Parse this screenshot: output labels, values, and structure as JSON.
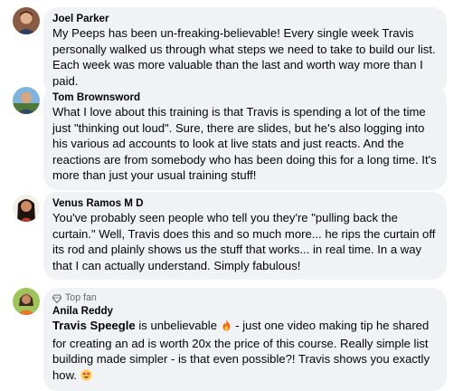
{
  "comments": [
    {
      "author": "Joel Parker",
      "text": "My Peeps has been un-freaking-believable! Every single week Travis personally walked us through what steps we need to take to build our list. Each week was more valuable than the last and worth way more than I paid."
    },
    {
      "author": "Tom Brownsword",
      "text": "What I love about this training is that Travis is spending a lot of the time just \"thinking out loud\". Sure, there are slides, but he's also logging into his various ad accounts to look at live stats and just reacts. And the reactions are from somebody who has been doing this for a long time. It's more than just your usual training stuff!"
    },
    {
      "author": "Venus Ramos M D",
      "text": "You've probably seen people who tell you they're \"pulling back the curtain.\" Well, Travis does this and so much more... he rips the curtain off its rod and plainly shows us the stuff that works... in real time. In a way that I can actually understand. Simply fabulous!"
    },
    {
      "badge": "Top fan",
      "author": "Anila Reddy",
      "mention": "Travis Speegle",
      "text_a": " is unbelievable ",
      "text_b": " - just one video making tip he shared for creating an ad is worth 20x the price of this course. Really simple list building made simpler - is that even possible?! Travis shows you exactly how. ",
      "emoji_fire": "fire-emoji",
      "emoji_eyes": "heart-eyes-emoji"
    }
  ]
}
